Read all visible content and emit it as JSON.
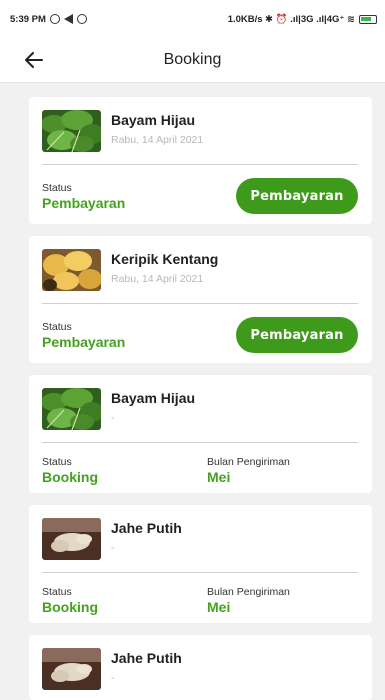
{
  "statusbar": {
    "time": "5:39 PM",
    "right_text": "1.0KB/s ✱ ⏰ .ıl|3G .ıl|4G⁺ ≋"
  },
  "appbar": {
    "title": "Booking"
  },
  "bookings": [
    {
      "name": "Bayam Hijau",
      "date": "Rabu, 14 April 2021",
      "status_label": "Status",
      "status_value": "Pembayaran",
      "button_label": "Pembayaran",
      "thumb": "spinach"
    },
    {
      "name": "Keripik Kentang",
      "date": "Rabu, 14 April 2021",
      "status_label": "Status",
      "status_value": "Pembayaran",
      "button_label": "Pembayaran",
      "thumb": "chips"
    },
    {
      "name": "Bayam Hijau",
      "date": "-",
      "status_label": "Status",
      "status_value": "Booking",
      "month_label": "Bulan Pengiriman",
      "month_value": "Mei",
      "thumb": "spinach"
    },
    {
      "name": "Jahe Putih",
      "date": "-",
      "status_label": "Status",
      "status_value": "Booking",
      "month_label": "Bulan Pengiriman",
      "month_value": "Mei",
      "thumb": "ginger"
    },
    {
      "name": "Jahe Putih",
      "date": "-",
      "thumb": "ginger"
    }
  ],
  "colors": {
    "accent": "#3e9a1a",
    "status_text": "#44a21f"
  }
}
